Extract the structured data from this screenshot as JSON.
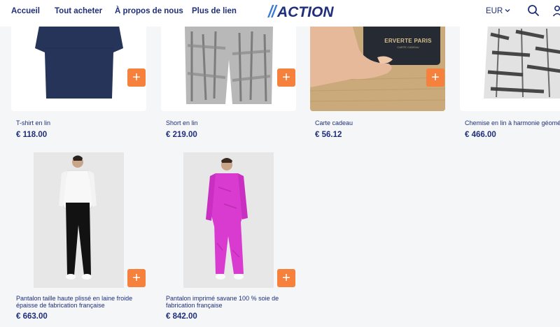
{
  "header": {
    "nav": [
      "Accueil",
      "Tout acheter",
      "À propos de nous",
      "Plus de lien"
    ],
    "logo_text": "ACTION",
    "currency": "EUR"
  },
  "colors": {
    "brand": "#1f2f7a",
    "accent": "#f5813d",
    "background": "#f5f6f8"
  },
  "products": [
    {
      "name": "T-shirt en lin",
      "price": "€ 118.00",
      "add_label": "+"
    },
    {
      "name": "Short en lin",
      "price": "€ 219.00",
      "add_label": "+"
    },
    {
      "name": "Carte cadeau",
      "price": "€ 56.12",
      "add_label": "+",
      "card_brand": "ERVERTE PARIS",
      "card_sub": "CARTE CADEAU"
    },
    {
      "name": "Chemise en lin à harmonie géométrique",
      "price": "€ 466.00",
      "add_label": "+"
    },
    {
      "name_line1": "Pantalon taille haute plissé en laine froide",
      "name_line2": "épaisse de fabrication française",
      "price": "€ 663.00",
      "add_label": "+"
    },
    {
      "name_line1": "Pantalon imprimé savane 100 % soie de",
      "name_line2": "fabrication française",
      "price": "€ 842.00",
      "add_label": "+"
    }
  ]
}
